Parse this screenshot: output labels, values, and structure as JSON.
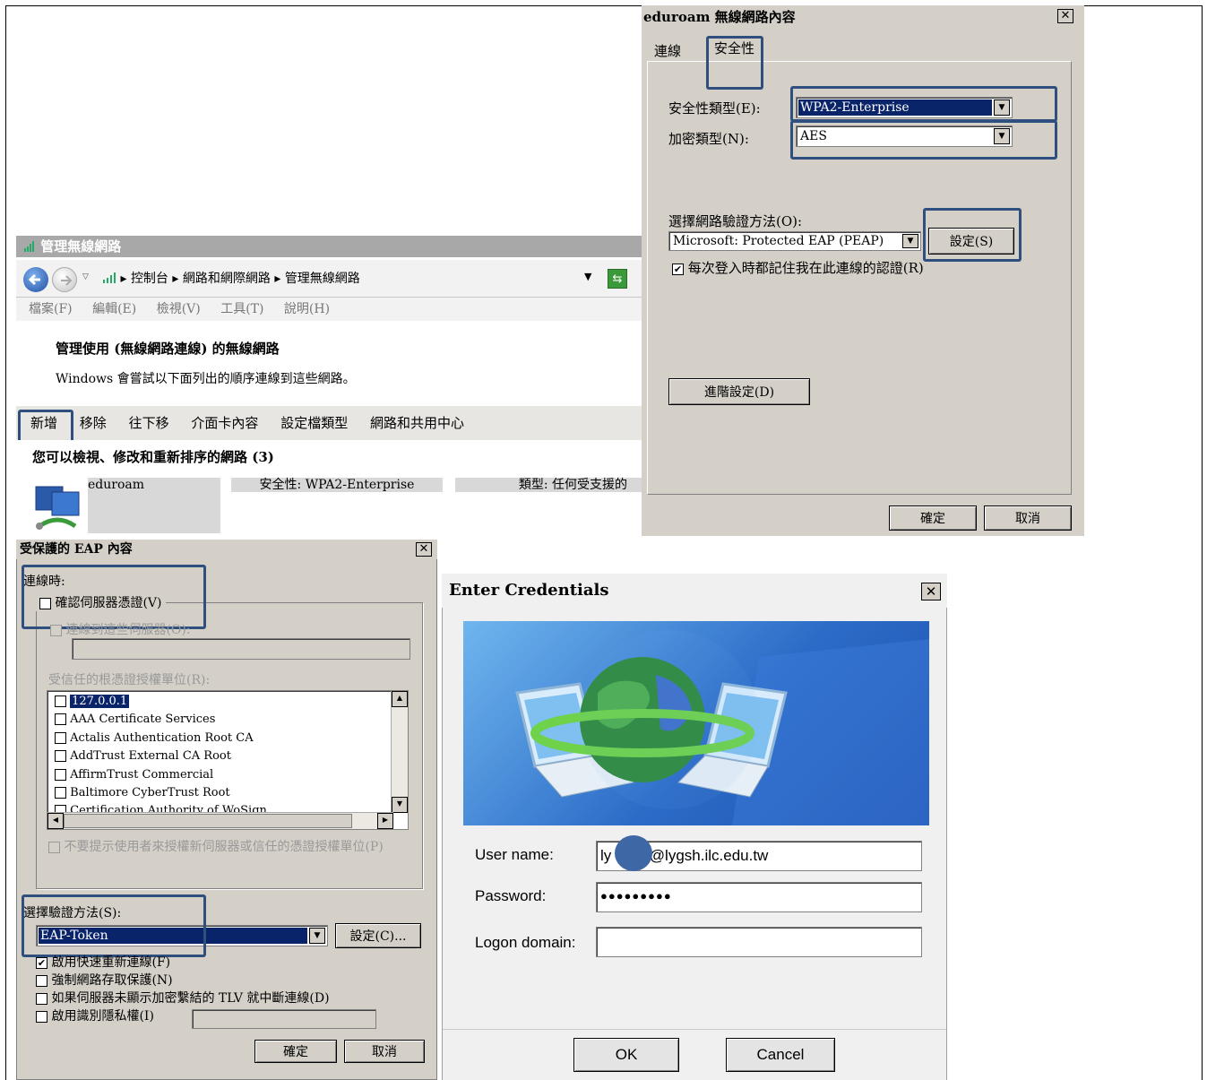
{
  "manage_wireless": {
    "title": "管理無線網路",
    "breadcrumb": [
      "控制台",
      "網路和網際網路",
      "管理無線網路"
    ],
    "menu": [
      "檔案(F)",
      "編輯(E)",
      "檢視(V)",
      "工具(T)",
      "說明(H)"
    ],
    "heading": "管理使用 (無線網路連線) 的無線網路",
    "subtext": "Windows 會嘗試以下面列出的順序連線到這些網路。",
    "toolbar": [
      "新增",
      "移除",
      "往下移",
      "介面卡內容",
      "設定檔類型",
      "網路和共用中心"
    ],
    "list_header": "您可以檢視、修改和重新排序的網路 (3)",
    "network": {
      "name": "eduroam",
      "security": "安全性: WPA2-Enterprise",
      "type": "類型: 任何受支援的"
    }
  },
  "eduroam_props": {
    "title": "eduroam 無線網路內容",
    "tabs": [
      "連線",
      "安全性"
    ],
    "security_type_label": "安全性類型(E):",
    "security_type_value": "WPA2-Enterprise",
    "encryption_label": "加密類型(N):",
    "encryption_value": "AES",
    "auth_method_label": "選擇網路驗證方法(O):",
    "auth_method_value": "Microsoft: Protected EAP (PEAP)",
    "settings_button": "設定(S)",
    "remember_label": "每次登入時都記住我在此連線的認證(R)",
    "advanced_button": "進階設定(D)",
    "ok_button": "確定",
    "cancel_button": "取消"
  },
  "eap_props": {
    "title": "受保護的 EAP 內容",
    "when_connecting": "連線時:",
    "validate_cert": "確認伺服器憑證(V)",
    "connect_servers": "連線到這些伺服器(O):",
    "trusted_roots_label": "受信任的根憑證授權單位(R):",
    "trusted_roots": [
      "127.0.0.1",
      "AAA Certificate Services",
      "Actalis Authentication Root CA",
      "AddTrust External CA Root",
      "AffirmTrust Commercial",
      "Baltimore CyberTrust Root",
      "Certification Authority of WoSign"
    ],
    "no_prompt": "不要提示使用者來授權新伺服器或信任的憑證授權單位(P)",
    "select_method_label": "選擇驗證方法(S):",
    "method_value": "EAP-Token",
    "config_button": "設定(C)...",
    "options": [
      {
        "label": "啟用快速重新連線(F)",
        "checked": true
      },
      {
        "label": "強制網路存取保護(N)",
        "checked": false
      },
      {
        "label": "如果伺服器未顯示加密繫結的 TLV 就中斷連線(D)",
        "checked": false
      },
      {
        "label": "啟用識別隱私權(I)",
        "checked": false
      }
    ],
    "ok_button": "確定",
    "cancel_button": "取消"
  },
  "credentials": {
    "title": "Enter Credentials",
    "username_label": "User name:",
    "username_value": "ly     ad@lygsh.ilc.edu.tw",
    "password_label": "Password:",
    "password_value": "●●●●●●●●●",
    "domain_label": "Logon domain:",
    "domain_value": "",
    "ok_button": "OK",
    "cancel_button": "Cancel"
  }
}
